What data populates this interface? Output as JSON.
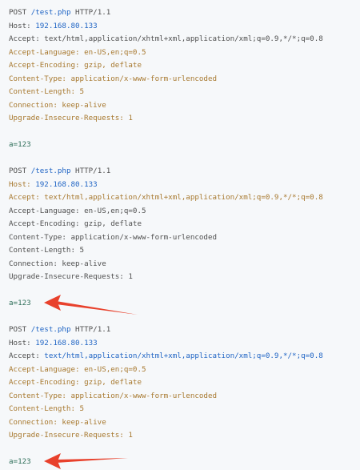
{
  "requests": [
    {
      "method": "POST",
      "path": "/test.php",
      "version": "HTTP/1.1",
      "headers": [
        {
          "key": "Host:",
          "value": "192.168.80.133"
        },
        {
          "key": "Accept:",
          "value": "text/html,application/xhtml+xml,application/xml;q=0.9,*/*;q=0.8"
        },
        {
          "key": "Accept-Language:",
          "value": "en-US,en;q=0.5"
        },
        {
          "key": "Accept-Encoding:",
          "value": "gzip, deflate"
        },
        {
          "key": "Content-Type:",
          "value": "application/x-www-form-urlencoded"
        },
        {
          "key": "Content-Length:",
          "value": "5"
        },
        {
          "key": "Connection:",
          "value": "keep-alive"
        },
        {
          "key": "Upgrade-Insecure-Requests:",
          "value": "1"
        }
      ],
      "body": "a=123"
    },
    {
      "method": "POST",
      "path": "/test.php",
      "version": "HTTP/1.1",
      "headers": [
        {
          "key": "Host:",
          "value": "192.168.80.133"
        },
        {
          "key": "Accept:",
          "value": "text/html,application/xhtml+xml,application/xml;q=0.9,*/*;q=0.8"
        },
        {
          "key": "Accept-Language:",
          "value": "en-US,en;q=0.5"
        },
        {
          "key": "Accept-Encoding:",
          "value": "gzip, deflate"
        },
        {
          "key": "Content-Type:",
          "value": "application/x-www-form-urlencoded"
        },
        {
          "key": "Content-Length:",
          "value": "5"
        },
        {
          "key": "Connection:",
          "value": "keep-alive"
        },
        {
          "key": "Upgrade-Insecure-Requests:",
          "value": "1"
        }
      ],
      "body": "a=123"
    },
    {
      "method": "POST",
      "path": "/test.php",
      "version": "HTTP/1.1",
      "headers": [
        {
          "key": "Host:",
          "value": "192.168.80.133"
        },
        {
          "key": "Accept:",
          "value": "text/html,application/xhtml+xml,application/xml;q=0.9,*/*;q=0.8"
        },
        {
          "key": "Accept-Language:",
          "value": "en-US,en;q=0.5"
        },
        {
          "key": "Accept-Encoding:",
          "value": "gzip, deflate"
        },
        {
          "key": "Content-Type:",
          "value": "application/x-www-form-urlencoded"
        },
        {
          "key": "Content-Length:",
          "value": "5"
        },
        {
          "key": "Connection:",
          "value": "keep-alive"
        },
        {
          "key": "Upgrade-Insecure-Requests:",
          "value": "1"
        }
      ],
      "body": "a=123"
    }
  ],
  "annotations": {
    "arrow_color": "#e8412c"
  },
  "colors": {
    "background": "#f6f8fa",
    "path_blue": "#1f64c4",
    "header_gold": "#a7782e",
    "text_grey": "#4f4f4f",
    "body_teal": "#2f6f5a"
  }
}
